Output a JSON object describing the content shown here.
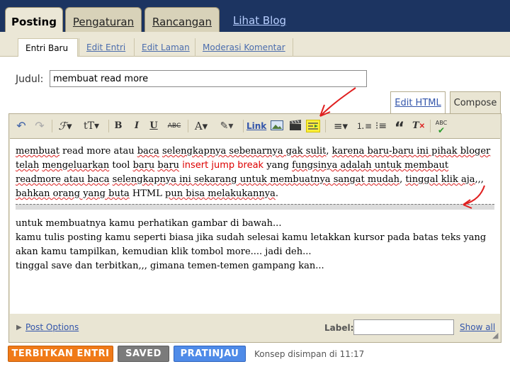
{
  "top_tabs": [
    {
      "label": "Posting"
    },
    {
      "label": "Pengaturan"
    },
    {
      "label": "Rancangan"
    }
  ],
  "view_blog_label": "Lihat Blog",
  "sub_tabs": [
    {
      "label": "Entri Baru"
    },
    {
      "label": "Edit Entri"
    },
    {
      "label": "Edit Laman"
    },
    {
      "label": "Moderasi Komentar"
    }
  ],
  "title_field": {
    "label": "Judul:",
    "value": "membuat read more"
  },
  "mode_tabs": {
    "edit_html": "Edit HTML",
    "compose": "Compose"
  },
  "toolbar": {
    "link_label": "Link"
  },
  "content": {
    "p1_a": "membuat",
    "p1_b": " read more atau ",
    "p1_c": "baca",
    "p1_d": " ",
    "p1_e": "selengkapnya sebenarnya gak sulit",
    "p1_f": ", ",
    "p1_g": "karena baru-baru ini pihak bloger telah",
    "p1_h": " ",
    "p1_i": "mengeluarkan",
    "p1_j": " tool ",
    "p1_k": "baru",
    "p1_l": "  ",
    "p1_m": "baru",
    "p1_n": "  ",
    "p1_jump": "insert jump break",
    "p1_o": " yang ",
    "p1_p": "fungsinya adalah untuk membaut readmore atau baca",
    "p1_q": " ",
    "p1_r": "selengkapnya ini sekarang untuk membuatnya sangat mudah",
    "p1_s": ", ",
    "p1_t": "tinggal klik aja",
    "p1_u": ",,, ",
    "p1_v": "bahkan orang yang buta",
    "p1_w": " HTML ",
    "p1_x": "pun bisa melakukannya",
    "p1_y": ".",
    "p2": "untuk membuatnya kamu perhatikan gambar di bawah...",
    "p3": "kamu tulis posting kamu seperti biasa jika sudah selesai kamu letakkan kursor pada batas teks yang akan kamu tampilkan, kemudian klik tombol more.... jadi deh...",
    "p4": "tinggal save dan terbitkan,,, gimana temen-temen gampang kan..."
  },
  "post_options_label": "Post Options",
  "labels_field": {
    "label": "Label:",
    "value": ""
  },
  "show_all_label": "Show all",
  "buttons": {
    "publish": "TERBITKAN ENTRI",
    "saved": "SAVED",
    "preview": "PRATINJAU"
  },
  "status_text": "Konsep disimpan di 11:17",
  "colors": {
    "top_bar": "#1c3461",
    "publish": "#f07a18",
    "saved": "#7b7b7b",
    "preview": "#4f8be8",
    "annotation": "#e02020"
  }
}
